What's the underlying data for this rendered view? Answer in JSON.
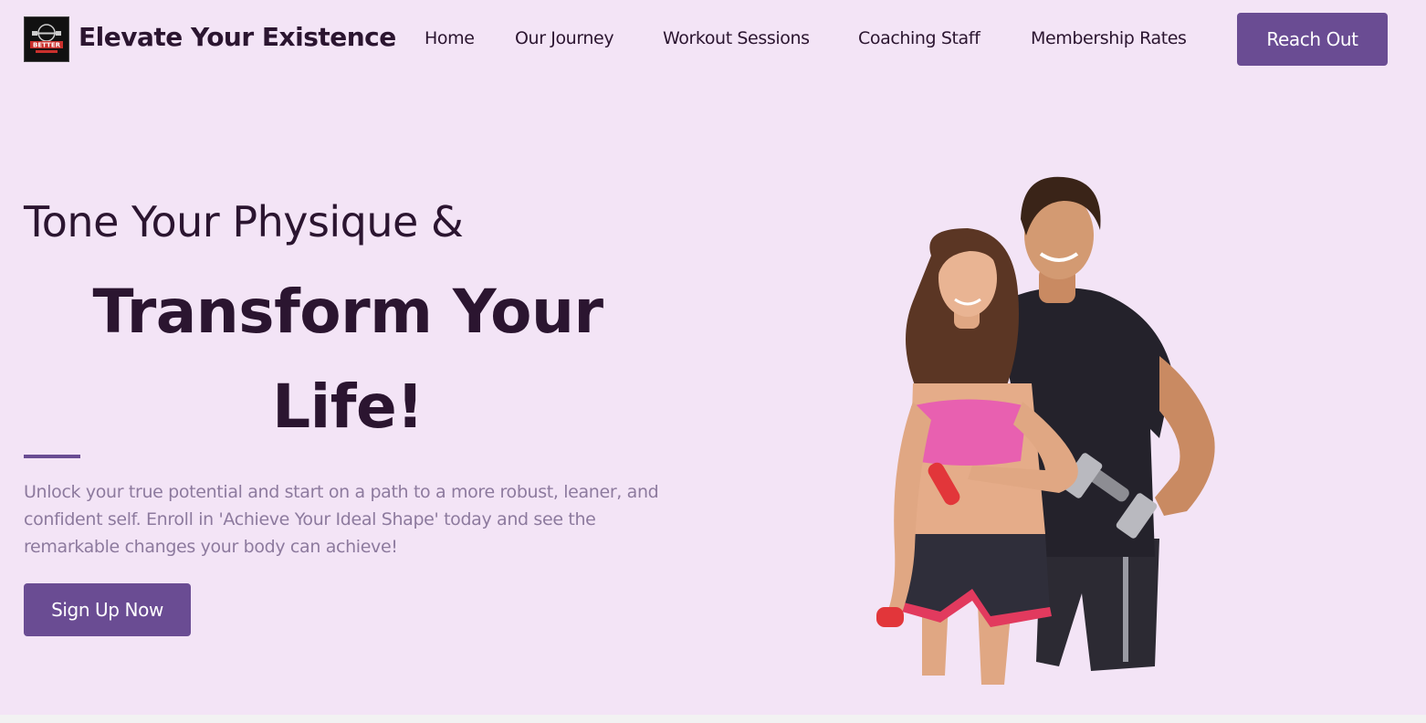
{
  "header": {
    "logo_icon": "gym-badge-icon",
    "logo_text": "BETTER",
    "brand": "Elevate Your Existence",
    "nav": [
      {
        "label": "Home"
      },
      {
        "label": "Our Journey"
      },
      {
        "label": "Workout Sessions"
      },
      {
        "label": "Coaching Staff"
      },
      {
        "label": "Membership Rates"
      }
    ],
    "cta_label": "Reach Out"
  },
  "hero": {
    "eyebrow": "Tone Your Physique &",
    "title_line1": "Transform Your",
    "title_line2": "Life!",
    "description": "Unlock your true potential and start on a path to a more robust, leaner, and confident self. Enroll in 'Achieve Your Ideal Shape' today and see the remarkable changes your body can achieve!",
    "button_label": "Sign Up Now",
    "image_icon": "fitness-couple-illustration"
  },
  "colors": {
    "background": "#f3e4f6",
    "accent": "#6a4c93",
    "text": "#2b1530",
    "muted_text": "#8d7a9e"
  }
}
